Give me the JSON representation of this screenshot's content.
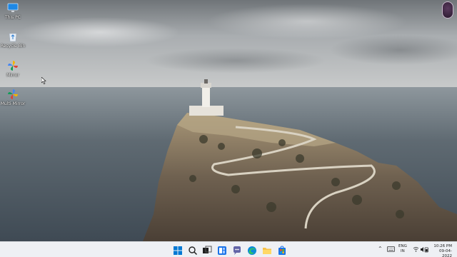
{
  "desktop": {
    "icons": [
      {
        "label": "This PC",
        "icon": "monitor-icon"
      },
      {
        "label": "Recycle Bin",
        "icon": "recycle-bin-icon"
      },
      {
        "label": "Mirror",
        "icon": "pinwheel-app-icon"
      },
      {
        "label": "Multi-Mirror",
        "icon": "pinwheel-app-icon"
      }
    ]
  },
  "taskbar": {
    "pinned": [
      {
        "name": "start-button",
        "icon": "windows-logo-icon"
      },
      {
        "name": "search-button",
        "icon": "search-icon"
      },
      {
        "name": "task-view-button",
        "icon": "task-view-icon"
      },
      {
        "name": "widgets-button",
        "icon": "widgets-icon"
      },
      {
        "name": "chat-button",
        "icon": "teams-chat-icon"
      },
      {
        "name": "edge-button",
        "icon": "edge-browser-icon"
      },
      {
        "name": "file-explorer-button",
        "icon": "folder-icon"
      },
      {
        "name": "store-button",
        "icon": "store-icon"
      }
    ],
    "tray": {
      "language_line1": "ENG",
      "language_line2": "IN",
      "time": "10:26 PM",
      "date": "09-04-2022"
    }
  },
  "colors": {
    "taskbar_bg": "#eef0f4",
    "accent": "#0078d4"
  }
}
